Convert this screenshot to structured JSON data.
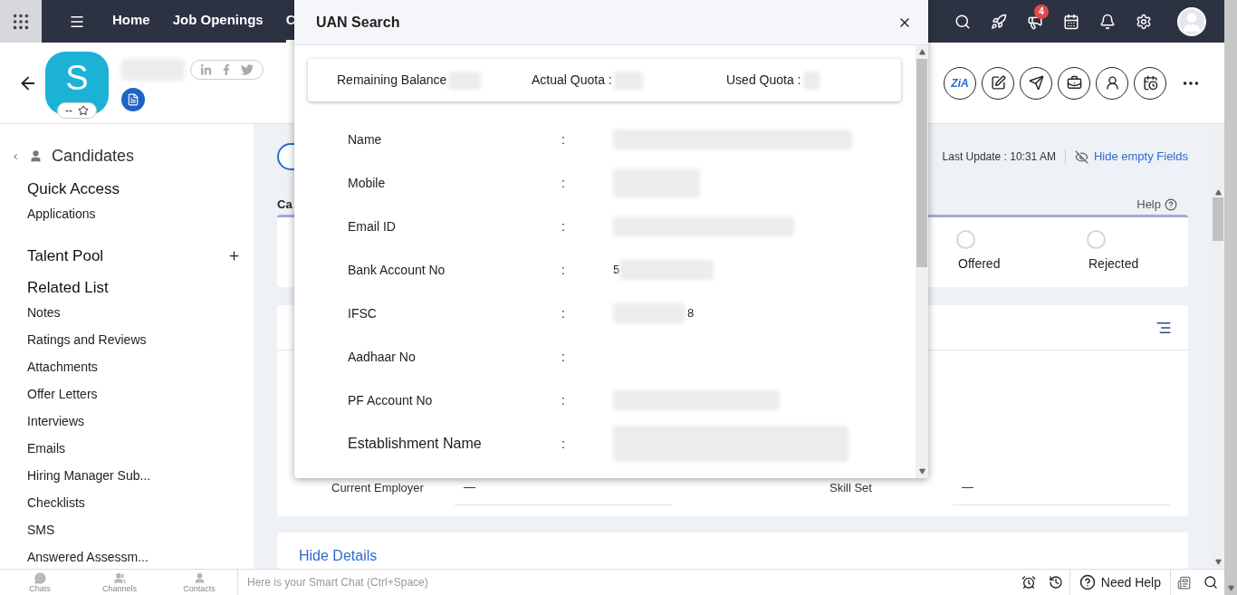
{
  "topbar": {
    "nav": [
      {
        "label": "Home",
        "selected": false
      },
      {
        "label": "Job Openings",
        "selected": false
      },
      {
        "label": "C",
        "selected": true
      }
    ],
    "notification_count": "4"
  },
  "record": {
    "avatar_letter": "S",
    "rating": "--",
    "assistant_logo": "ZiA"
  },
  "sidebar": {
    "module": "Candidates",
    "sections": [
      {
        "title": "Quick Access",
        "addable": false,
        "items": [
          "Applications"
        ]
      },
      {
        "title": "Talent Pool",
        "addable": true
      },
      {
        "title": "Related List",
        "addable": false,
        "items": [
          "Notes",
          "Ratings and Reviews",
          "Attachments",
          "Offer Letters",
          "Interviews",
          "Emails",
          "Hiring Manager Sub...",
          "Checklists",
          "SMS",
          "Answered Assessm..."
        ]
      }
    ]
  },
  "main": {
    "last_update": "Last Update : 10:31 AM",
    "hide_empty": "Hide empty Fields",
    "section_label": "Ca",
    "help": "Help",
    "statuses": [
      {
        "label": "Offered",
        "selected": false
      },
      {
        "label": "Rejected",
        "selected": false
      }
    ],
    "fields": [
      {
        "label": "Current Employer",
        "value": "—"
      },
      {
        "label": "Skill Set",
        "value": "—"
      }
    ],
    "hide_details": "Hide Details"
  },
  "modal": {
    "title": "UAN Search",
    "quota": [
      "Remaining Balance",
      "Actual Quota :",
      "Used Quota :"
    ],
    "rows": [
      {
        "label": "Name",
        "colon": ":",
        "redacted": true
      },
      {
        "label": "Mobile",
        "colon": ":",
        "redacted": true
      },
      {
        "label": "Email ID",
        "colon": ":",
        "redacted": true
      },
      {
        "label": "Bank Account No",
        "colon": ":",
        "redacted": true,
        "visible_start": "5"
      },
      {
        "label": "IFSC",
        "colon": ":",
        "redacted": true,
        "visible_end": "8"
      },
      {
        "label": "Aadhaar No",
        "colon": ":",
        "redacted": false
      },
      {
        "label": "PF Account No",
        "colon": ":",
        "redacted": true
      },
      {
        "label": "Establishment Name",
        "colon": ":",
        "redacted": true
      }
    ]
  },
  "bottom_bar": {
    "tabs": [
      "Chats",
      "Channels",
      "Contacts"
    ],
    "chat_placeholder": "Here is your Smart Chat (Ctrl+Space)",
    "help": "Need Help"
  }
}
